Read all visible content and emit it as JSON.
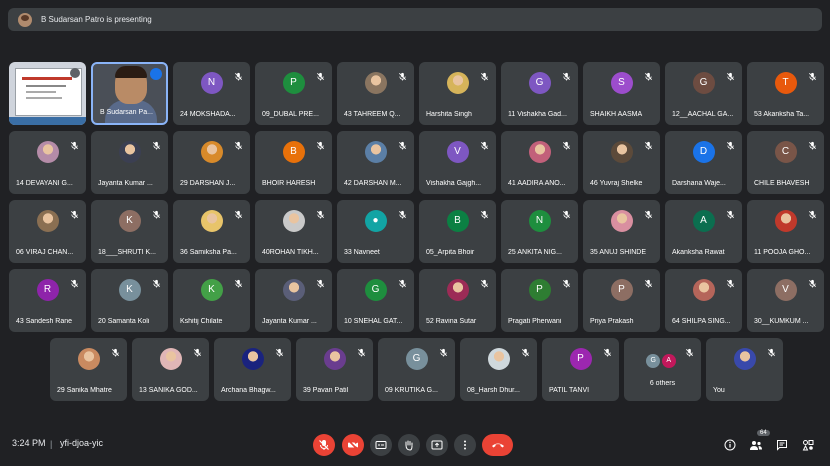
{
  "banner": {
    "text": "B Sudarsan Patro is presenting"
  },
  "colors": {
    "bg": "#202124",
    "tile": "#3c4043",
    "danger": "#ea4335"
  },
  "tiles": [
    {
      "kind": "presentation",
      "label": ""
    },
    {
      "kind": "speaker",
      "label": "B Sudarsan Pa..."
    },
    {
      "kind": "letter",
      "letter": "N",
      "color": "#7e57c2",
      "label": "24 MOKSHADA..."
    },
    {
      "kind": "letter",
      "letter": "P",
      "color": "#1e8e3e",
      "label": "09_DUBAL PRE..."
    },
    {
      "kind": "photo",
      "color": "#8a7560",
      "label": "43 TAHREEM Q..."
    },
    {
      "kind": "photo",
      "color": "#d6b45a",
      "label": "Harshita Singh"
    },
    {
      "kind": "letter",
      "letter": "G",
      "color": "#7e57c2",
      "label": "11 Vishakha Gad..."
    },
    {
      "kind": "letter",
      "letter": "S",
      "color": "#9c4dcc",
      "label": "SHAIKH AASMA"
    },
    {
      "kind": "letter",
      "letter": "G",
      "color": "#6d4c41",
      "label": "12__AACHAL GA..."
    },
    {
      "kind": "letter",
      "letter": "T",
      "color": "#e8590c",
      "label": "53 Akanksha Ta..."
    },
    {
      "kind": "photo",
      "color": "#b58ca8",
      "label": "14 DEVAYANI G..."
    },
    {
      "kind": "photo",
      "color": "#3b3f52",
      "label": "Jayanta Kumar ..."
    },
    {
      "kind": "photo",
      "color": "#d88a2a",
      "label": "29 DARSHAN J..."
    },
    {
      "kind": "letter",
      "letter": "B",
      "color": "#e8710a",
      "label": "BHOIR HARESH"
    },
    {
      "kind": "photo",
      "color": "#5b7fa6",
      "label": "42 DARSHAN M..."
    },
    {
      "kind": "letter",
      "letter": "V",
      "color": "#7e57c2",
      "label": "Vishakha Gajgh..."
    },
    {
      "kind": "photo",
      "color": "#c2607a",
      "label": "41 AADIRA ANO..."
    },
    {
      "kind": "photo",
      "color": "#5c4a3a",
      "label": "46 Yuvraj Shelke"
    },
    {
      "kind": "letter",
      "letter": "D",
      "color": "#1a73e8",
      "label": "Darshana Waje..."
    },
    {
      "kind": "letter",
      "letter": "C",
      "color": "#795548",
      "label": "CHILE BHAVESH"
    },
    {
      "kind": "photo",
      "color": "#8a6f52",
      "label": "06 VIRAJ CHAN..."
    },
    {
      "kind": "letter",
      "letter": "K",
      "color": "#8d6e63",
      "label": "18___SHRUTI K..."
    },
    {
      "kind": "photo",
      "color": "#e8c46a",
      "label": "36 Samiksha Pa..."
    },
    {
      "kind": "photo",
      "color": "#c9c9c9",
      "label": "40ROHAN TIKH..."
    },
    {
      "kind": "letter",
      "letter": "●",
      "color": "#12a4a4",
      "label": "33 Navneet"
    },
    {
      "kind": "letter",
      "letter": "B",
      "color": "#0b8043",
      "label": "05_Arpita Bhoir"
    },
    {
      "kind": "letter",
      "letter": "N",
      "color": "#1e8e3e",
      "label": "25 ANKITA NIG..."
    },
    {
      "kind": "photo",
      "color": "#d98fa0",
      "label": "35 ANUJ SHINDE"
    },
    {
      "kind": "letter",
      "letter": "A",
      "color": "#0b6e4f",
      "label": "Akanksha Rawat"
    },
    {
      "kind": "photo",
      "color": "#c0392b",
      "label": "11 POOJA GHO..."
    },
    {
      "kind": "letter",
      "letter": "R",
      "color": "#8e24aa",
      "label": "43 Sandesh Rane"
    },
    {
      "kind": "letter",
      "letter": "K",
      "color": "#78909c",
      "label": "20 Samanta Koli"
    },
    {
      "kind": "letter",
      "letter": "K",
      "color": "#43a047",
      "label": "Kshitij Chilate"
    },
    {
      "kind": "photo",
      "color": "#5a5e78",
      "label": "Jayanta Kumar ..."
    },
    {
      "kind": "letter",
      "letter": "G",
      "color": "#1e8e3e",
      "label": "10 SNEHAL GAT..."
    },
    {
      "kind": "photo",
      "color": "#9c2b56",
      "label": "52 Ravina Sutar"
    },
    {
      "kind": "letter",
      "letter": "P",
      "color": "#2e7d32",
      "label": "Pragati Pherwani"
    },
    {
      "kind": "letter",
      "letter": "P",
      "color": "#8d6e63",
      "label": "Priya Prakash"
    },
    {
      "kind": "photo",
      "color": "#b5655a",
      "label": "64 SHILPA SING..."
    },
    {
      "kind": "letter",
      "letter": "V",
      "color": "#8d6e63",
      "label": "30__KUMKUM ..."
    },
    {
      "kind": "photo",
      "color": "#c98a60",
      "label": "29 Sanika Mhatre"
    },
    {
      "kind": "photo",
      "color": "#e0b6b6",
      "label": "13 SANIKA GOD..."
    },
    {
      "kind": "photo",
      "color": "#1a237e",
      "label": "Archana Bhagw..."
    },
    {
      "kind": "photo",
      "color": "#6a3d8f",
      "label": "39 Pavan Patil"
    },
    {
      "kind": "letter",
      "letter": "G",
      "color": "#78909c",
      "label": "09 KRUTIKA G..."
    },
    {
      "kind": "photo",
      "color": "#cfd8dc",
      "label": "08_Harsh Dhur..."
    },
    {
      "kind": "letter",
      "letter": "P",
      "color": "#9c27b0",
      "label": "PATIL TANVI"
    },
    {
      "kind": "others",
      "label": "6 others",
      "a": "G",
      "b": "A"
    },
    {
      "kind": "photo",
      "color": "#3949ab",
      "label": "You"
    }
  ],
  "bottom": {
    "time": "3:24 PM",
    "separator": "|",
    "meeting_code": "yfi-djoa-yic",
    "participants_count": "64"
  }
}
